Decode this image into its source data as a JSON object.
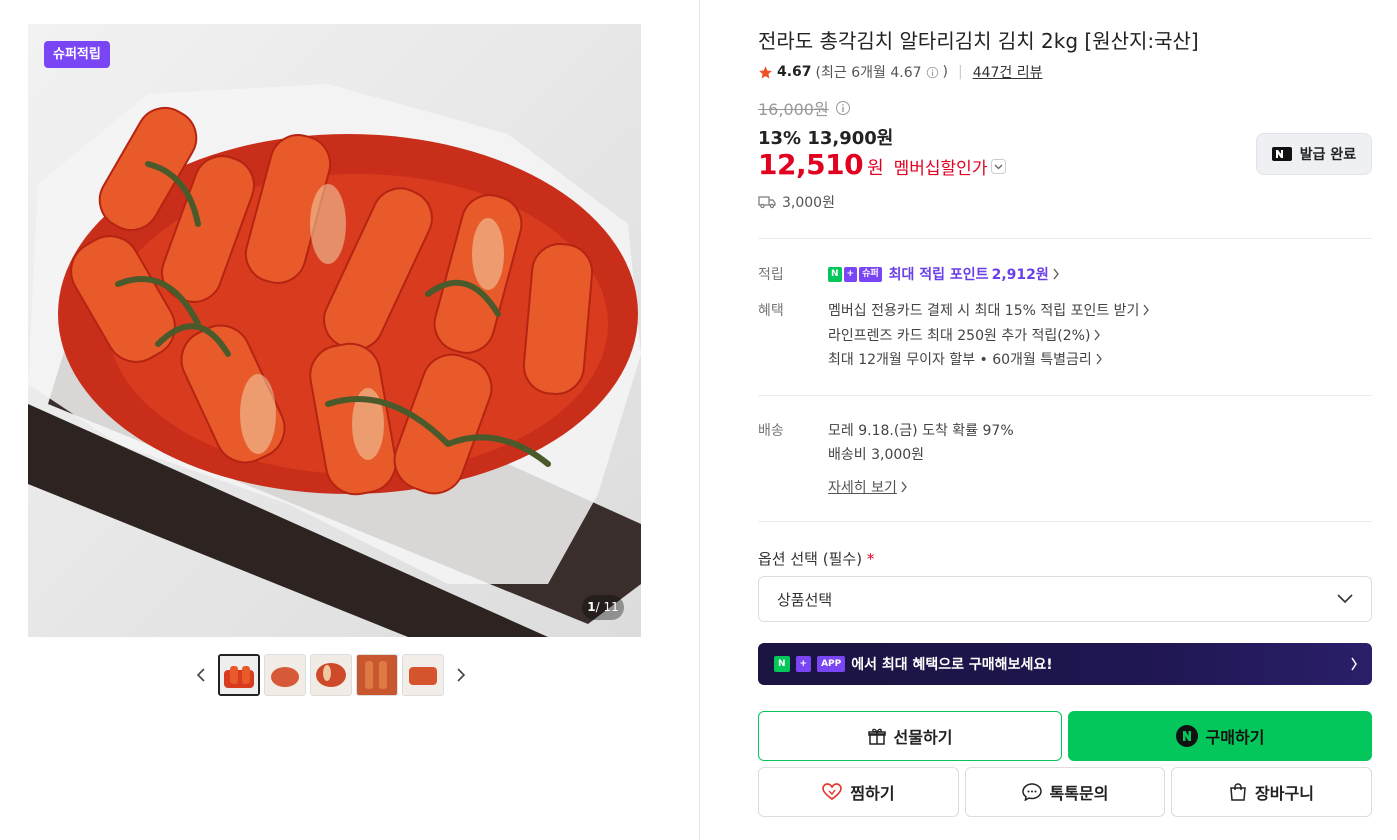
{
  "gallery": {
    "badge": "슈퍼적립",
    "counter_current": "1",
    "counter_total": "/ 11",
    "thumbnails": [
      "thumb-1",
      "thumb-2",
      "thumb-3",
      "thumb-4",
      "thumb-5"
    ],
    "prev_icon": "chevron-left-icon",
    "next_icon": "chevron-right-icon"
  },
  "product": {
    "title": "전라도 총각김치 알타리김치 김치 2kg [원산지:국산]",
    "rating_score": "4.67",
    "rating_recent": "(최근 6개월 4.67",
    "rating_recent_close": ")",
    "reviews": "447건 리뷰",
    "original_price": "16,000원",
    "discount_line": "13% 13,900원",
    "member_price": "12,510",
    "member_won": "원",
    "member_label": "멤버십할인가",
    "coupon_button": "발급 완료",
    "shipping_fee": "3,000원"
  },
  "benefits": {
    "points_label": "적립",
    "points_text": "최대 적립 포인트",
    "points_value": "2,912원",
    "benefit_label": "혜택",
    "benefit_items": [
      "멤버십 전용카드 결제 시 최대 15% 적립 포인트 받기",
      "라인프렌즈 카드 최대 250원 추가 적립(2%)",
      "최대 12개월 무이자 할부 • 60개월 특별금리"
    ]
  },
  "delivery": {
    "label": "배송",
    "arrival": "모레 9.18.(금) 도착 확률 97%",
    "fee": "배송비 3,000원",
    "detail_link": "자세히 보기"
  },
  "options": {
    "label": "옵션 선택 (필수)",
    "required_mark": "*",
    "select_value": "상품선택"
  },
  "banner": {
    "badge_n": "N",
    "badge_plus": "+",
    "badge_app": "APP",
    "text": "에서 최대 혜택으로 구매해보세요!"
  },
  "np_badges": {
    "n": "N",
    "plus": "+",
    "super": "슈퍼"
  },
  "actions": {
    "gift": "선물하기",
    "buy": "구매하기",
    "wish": "찜하기",
    "talk": "톡톡문의",
    "cart": "장바구니"
  },
  "colors": {
    "accent_green": "#03c75a",
    "discount_red": "#e10020",
    "super_purple": "#7a45f5"
  }
}
